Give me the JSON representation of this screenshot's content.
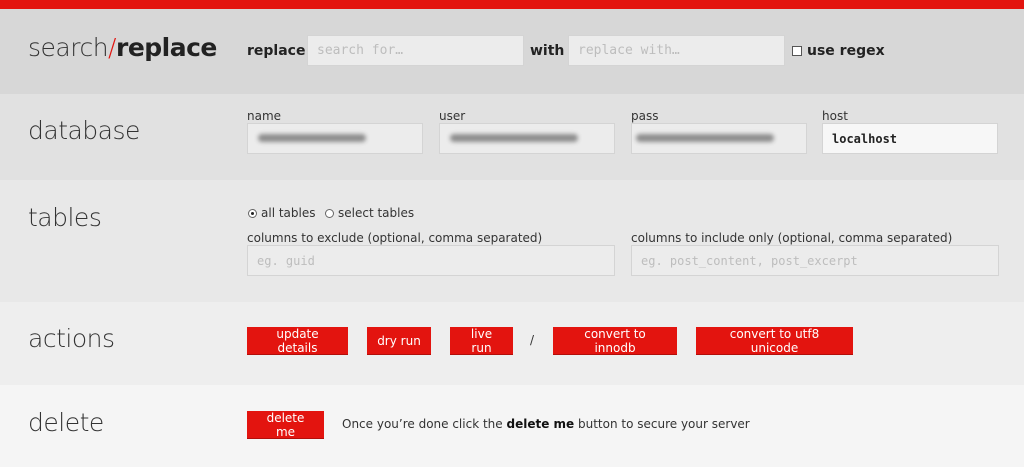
{
  "colors": {
    "accent": "#e3140f"
  },
  "search_replace": {
    "title_search": "search",
    "title_slash": "/",
    "title_replace": "replace",
    "replace_label": "replace",
    "search_placeholder": "search for…",
    "with_label": "with",
    "replace_placeholder": "replace with…",
    "regex_label": "use regex",
    "regex_checked": false
  },
  "database": {
    "title": "database",
    "name_label": "name",
    "user_label": "user",
    "pass_label": "pass",
    "host_label": "host",
    "host_value": "localhost"
  },
  "tables": {
    "title": "tables",
    "radio_all": "all tables",
    "radio_select": "select tables",
    "selected": "all tables",
    "exclude_label": "columns to exclude (optional, comma separated)",
    "exclude_placeholder": "eg. guid",
    "include_label": "columns to include only (optional, comma separated)",
    "include_placeholder": "eg. post_content, post_excerpt"
  },
  "actions": {
    "title": "actions",
    "update_details": "update details",
    "dry_run": "dry run",
    "live_run": "live run",
    "separator": "/",
    "convert_innodb": "convert to innodb",
    "convert_utf8": "convert to utf8 unicode"
  },
  "delete": {
    "title": "delete",
    "button": "delete me",
    "msg_before": "Once you’re done click the ",
    "msg_bold": "delete me",
    "msg_after": " button to secure your server"
  }
}
